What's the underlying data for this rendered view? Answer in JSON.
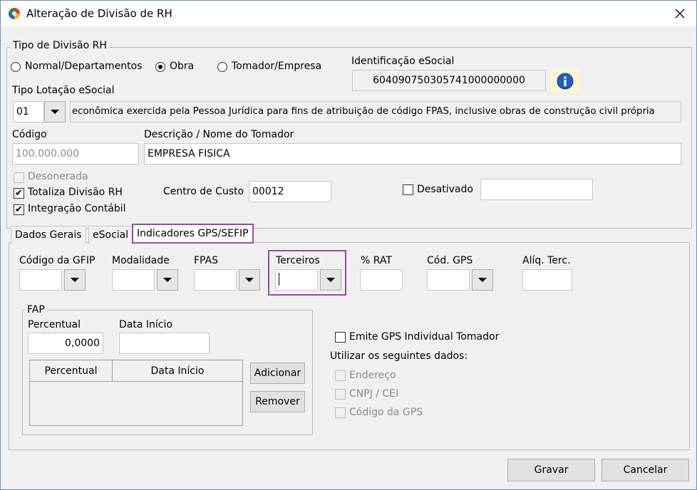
{
  "window": {
    "title": "Alteração de Divisão de RH"
  },
  "tipo_divisao": {
    "group_label": "Tipo de Divisão RH",
    "options": [
      {
        "label": "Normal/Departamentos",
        "checked": false
      },
      {
        "label": "Obra",
        "checked": true
      },
      {
        "label": "Tomador/Empresa",
        "checked": false
      }
    ]
  },
  "identificacao": {
    "label": "Identificação eSocial",
    "value": "604090750305741000000000"
  },
  "tipo_lotacao": {
    "label": "Tipo Lotação eSocial",
    "code": "01",
    "description": "econômica exercida pela Pessoa Jurídica para fins de atribuição de código FPAS, inclusive obras de construção civil própria"
  },
  "codigo": {
    "label": "Código",
    "value": "100.000.000"
  },
  "descricao": {
    "label": "Descrição / Nome do Tomador",
    "value": "EMPRESA FISICA"
  },
  "flags": {
    "desonerada": {
      "label": "Desonerada",
      "checked": false,
      "disabled": true
    },
    "totaliza": {
      "label": "Totaliza Divisão RH",
      "checked": true
    },
    "integracao": {
      "label": "Integração Contábil",
      "checked": true
    },
    "desativado": {
      "label": "Desativado",
      "checked": false,
      "value": ""
    }
  },
  "centro_custo": {
    "label": "Centro de Custo",
    "value": "00012"
  },
  "tabs": [
    {
      "label": "Dados Gerais",
      "active": false
    },
    {
      "label": "eSocial",
      "active": false
    },
    {
      "label": "Indicadores GPS/SEFIP",
      "active": true
    }
  ],
  "gps": {
    "codigo_gfip": {
      "label": "Código da GFIP",
      "value": ""
    },
    "modalidade": {
      "label": "Modalidade",
      "value": ""
    },
    "fpas": {
      "label": "FPAS",
      "value": ""
    },
    "terceiros": {
      "label": "Terceiros",
      "value": ""
    },
    "rat": {
      "label": "% RAT",
      "value": ""
    },
    "cod_gps": {
      "label": "Cód. GPS",
      "value": ""
    },
    "aliq_terc": {
      "label": "Alíq. Terc.",
      "value": ""
    }
  },
  "fap": {
    "group_label": "FAP",
    "percentual_label": "Percentual",
    "percentual_value": "0,0000",
    "data_inicio_label": "Data Início",
    "data_inicio_value": "",
    "columns": [
      "Percentual",
      "Data Início"
    ],
    "adicionar": "Adicionar",
    "remover": "Remover"
  },
  "emite": {
    "label": "Emite GPS Individual Tomador",
    "checked": false,
    "utilizar_label": "Utilizar os seguintes dados:",
    "options": [
      "Endereço",
      "CNPJ / CEI",
      "Código da GPS"
    ]
  },
  "buttons": {
    "gravar": "Gravar",
    "cancelar": "Cancelar"
  },
  "colors": {
    "highlight": "#9b4aa6",
    "info_blue": "#1f5fbf",
    "info_bg": "#fff6cf"
  }
}
